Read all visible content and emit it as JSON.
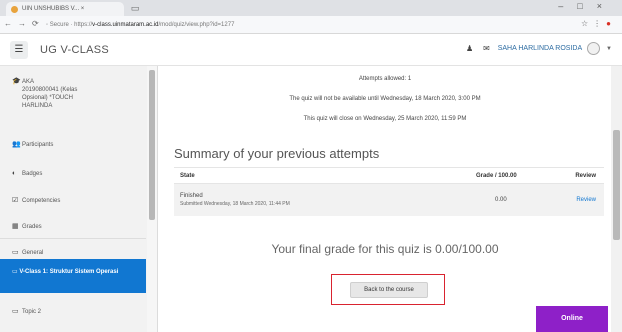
{
  "browser": {
    "tab_title": "UIN UNSHUBIBS V... ×",
    "url_prefix": "◦ Secure · https://",
    "url_domain": "v-class.uinmataram.ac.id",
    "url_path": "/mod/quiz/view.php?id=1277"
  },
  "navbar": {
    "menu_icon": "☰",
    "brand": "UG V-CLASS",
    "user_name": "SAHA HARLINDA ROSIDA"
  },
  "sidebar": {
    "course_lines": [
      "AKA",
      "20190800041 (Kelas",
      "Opsional) *TOUCH",
      "HARLINDA"
    ],
    "items": [
      "Participants",
      "Badges",
      "Competencies",
      "Grades",
      "General"
    ],
    "active_item": "V-Class 1: Struktur Sistem Operasi",
    "next_item": "Topic 2"
  },
  "main": {
    "attempts_allowed": "Attempts allowed: 1",
    "not_available": "The quiz will not be available until Wednesday, 18 March 2020, 3:00 PM",
    "will_close": "This quiz will close on Wednesday, 25 March 2020, 11:59 PM",
    "summary_title": "Summary of your previous attempts",
    "table": {
      "headers": [
        "State",
        "Grade / 100.00",
        "Review"
      ],
      "rows": [
        {
          "state": "Finished",
          "submitted": "Submitted Wednesday, 18 March 2020, 11:44 PM",
          "grade": "0.00",
          "review": "Review"
        }
      ]
    },
    "final_grade": "Your final grade for this quiz is 0.00/100.00",
    "back_button": "Back to the course",
    "online_button": "Online"
  }
}
